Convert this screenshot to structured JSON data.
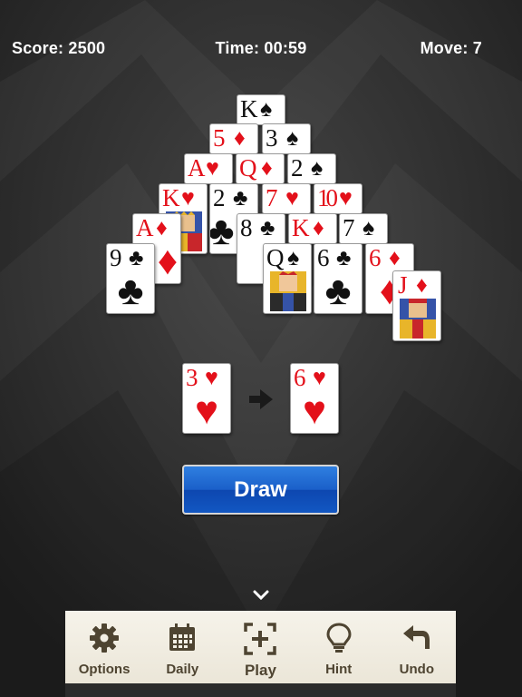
{
  "header": {
    "score": "Score: 2500",
    "time": "Time: 00:59",
    "move": "Move: 7"
  },
  "cards": [
    {
      "name": "card-5-diamonds",
      "rank": "5",
      "suit": "♦",
      "color": "red"
    },
    {
      "name": "card-3-spades",
      "rank": "3",
      "suit": "♠",
      "color": "black"
    },
    {
      "name": "card-ace-hearts",
      "rank": "A",
      "suit": "♥",
      "color": "red"
    },
    {
      "name": "card-queen-diamonds",
      "rank": "Q",
      "suit": "♦",
      "color": "red"
    },
    {
      "name": "card-2-spades",
      "rank": "2",
      "suit": "♠",
      "color": "black"
    },
    {
      "name": "card-king-spades",
      "rank": "K",
      "suit": "♠",
      "color": "black"
    },
    {
      "name": "card-king-hearts",
      "rank": "K",
      "suit": "♥",
      "color": "red"
    },
    {
      "name": "card-2-clubs",
      "rank": "2",
      "suit": "♣",
      "color": "black"
    },
    {
      "name": "card-7-hearts",
      "rank": "7",
      "suit": "♥",
      "color": "red"
    },
    {
      "name": "card-10-hearts",
      "rank": "10",
      "suit": "♥",
      "color": "red"
    },
    {
      "name": "card-ace-diamonds",
      "rank": "A",
      "suit": "♦",
      "color": "red"
    },
    {
      "name": "card-8-clubs",
      "rank": "8",
      "suit": "♣",
      "color": "black"
    },
    {
      "name": "card-king-diamonds",
      "rank": "K",
      "suit": "♦",
      "color": "red"
    },
    {
      "name": "card-7-spades",
      "rank": "7",
      "suit": "♠",
      "color": "black"
    },
    {
      "name": "card-9-clubs",
      "rank": "9",
      "suit": "♣",
      "color": "black"
    },
    {
      "name": "card-queen-spades",
      "rank": "Q",
      "suit": "♠",
      "color": "black"
    },
    {
      "name": "card-6-clubs",
      "rank": "6",
      "suit": "♣",
      "color": "black"
    },
    {
      "name": "card-6-diamonds",
      "rank": "6",
      "suit": "♦",
      "color": "red"
    },
    {
      "name": "card-jack-diamonds",
      "rank": "J",
      "suit": "♦",
      "color": "red"
    },
    {
      "name": "waste-card-3-hearts",
      "rank": "3",
      "suit": "♥",
      "color": "red"
    },
    {
      "name": "stock-card-6-hearts",
      "rank": "6",
      "suit": "♥",
      "color": "red"
    }
  ],
  "draw_button": {
    "label": "Draw"
  },
  "toolbar": {
    "options": "Options",
    "daily": "Daily",
    "play": "Play",
    "hint": "Hint",
    "undo": "Undo"
  },
  "colors": {
    "red_suit": "#e3101a",
    "black_suit": "#111111",
    "button_blue": "#1a5fc9",
    "toolbar_bg": "#f3efe4",
    "toolbar_text": "#4e4431"
  },
  "icons": [
    "gear-icon",
    "calendar-icon",
    "play-frame-icon",
    "lightbulb-icon",
    "undo-arrow-icon",
    "chevron-down-icon",
    "arrow-right-icon"
  ]
}
